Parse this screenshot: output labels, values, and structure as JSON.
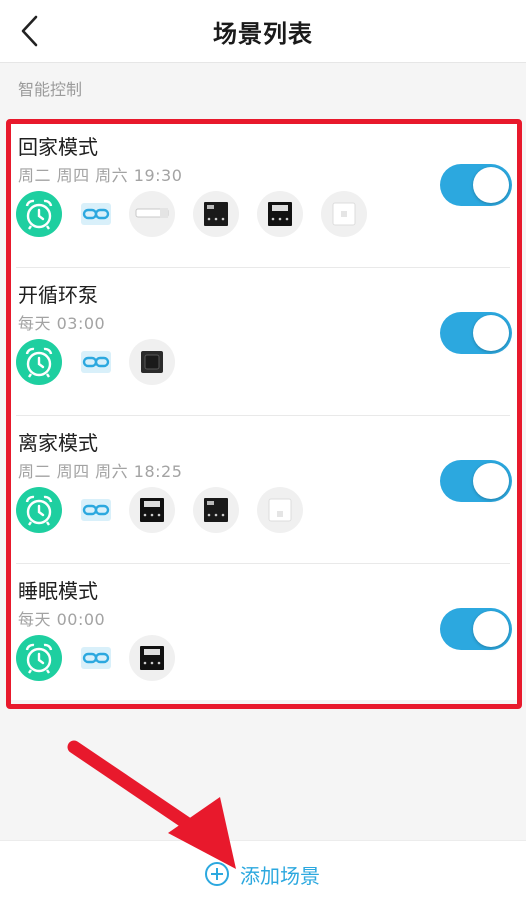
{
  "header": {
    "title": "场景列表"
  },
  "section": {
    "label": "智能控制"
  },
  "scenes": [
    {
      "name": "回家模式",
      "schedule": "周二 周四 周六 19:30",
      "enabled": true,
      "devices": [
        "curtain-motor-icon",
        "thermostat-panel-icon",
        "thermostat-panel-icon",
        "wall-switch-icon"
      ]
    },
    {
      "name": "开循环泵",
      "schedule": "每天 03:00",
      "enabled": true,
      "devices": [
        "pump-switch-icon"
      ]
    },
    {
      "name": "离家模式",
      "schedule": "周二 周四 周六 18:25",
      "enabled": true,
      "devices": [
        "thermostat-panel-icon",
        "thermostat-panel-icon",
        "wall-switch-icon"
      ]
    },
    {
      "name": "睡眠模式",
      "schedule": "每天 00:00",
      "enabled": true,
      "devices": [
        "thermostat-panel-icon"
      ]
    }
  ],
  "footer": {
    "add_label": "添加场景"
  },
  "colors": {
    "accent": "#2ca8df",
    "clock": "#1ecfa0",
    "highlight": "#e8192c"
  }
}
